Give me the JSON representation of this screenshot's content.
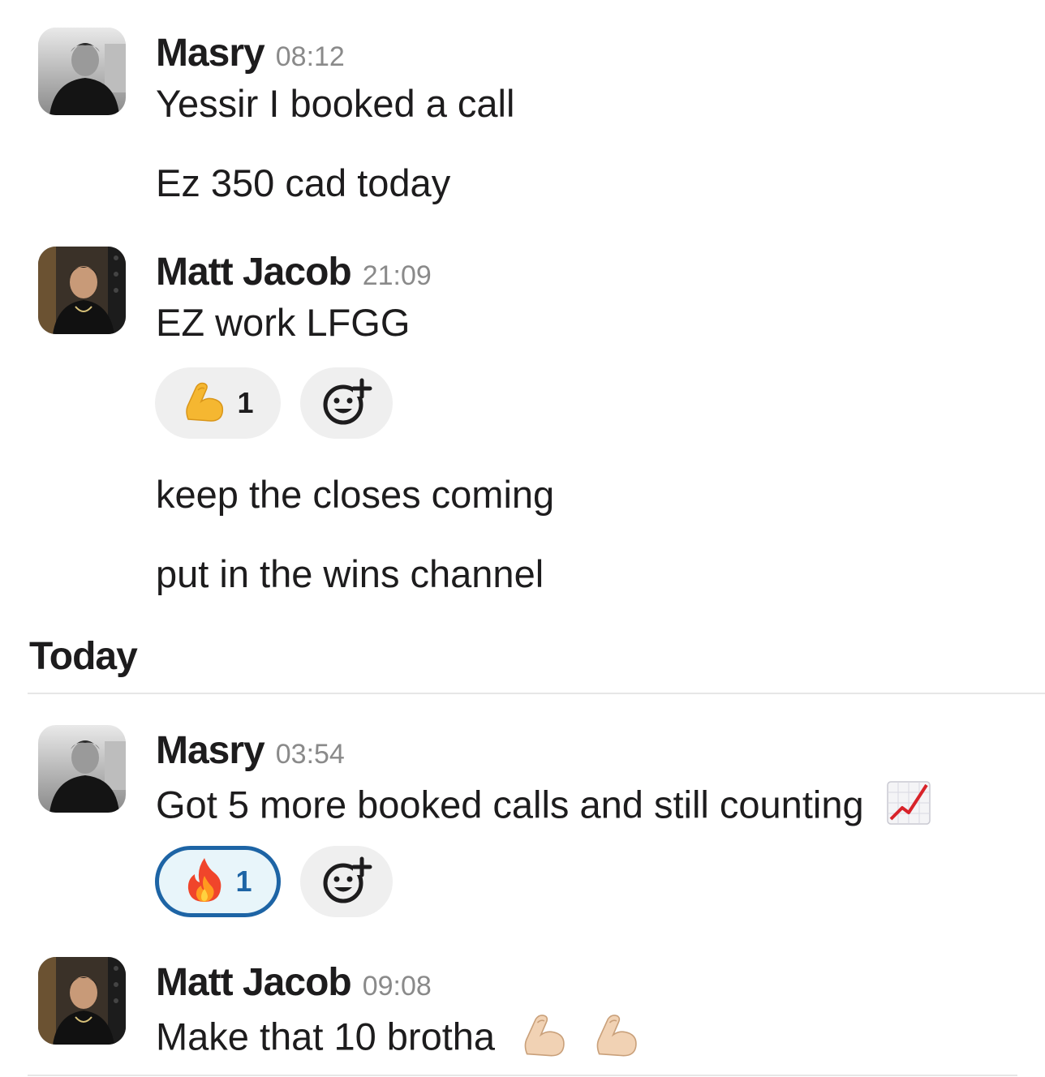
{
  "messages": [
    {
      "author": "Masry",
      "time": "08:12",
      "lines": [
        "Yessir I booked a call",
        "Ez 350 cad today"
      ]
    },
    {
      "author": "Matt Jacob",
      "time": "21:09",
      "lines": [
        "EZ work LFGG"
      ],
      "reaction": {
        "emoji": "flexed-biceps",
        "count": "1"
      },
      "after_lines": [
        "keep the closes coming",
        "put in the wins channel"
      ]
    },
    {
      "author": "Masry",
      "time": "03:54",
      "lines": [
        "Got 5 more booked calls and still counting"
      ],
      "inline_emoji": "chart-increasing",
      "reaction": {
        "emoji": "fire",
        "count": "1",
        "active": true
      }
    },
    {
      "author": "Matt Jacob",
      "time": "09:08",
      "lines": [
        "Make that 10 brotha"
      ],
      "inline_emoji": "flexed-biceps-light"
    }
  ],
  "day_divider": "Today",
  "colors": {
    "text": "#1d1c1d",
    "timestamp": "#8a8a8a",
    "reaction_bg": "#efefef",
    "reaction_active_border": "#1d64a5",
    "reaction_active_bg": "#e8f5fa"
  }
}
